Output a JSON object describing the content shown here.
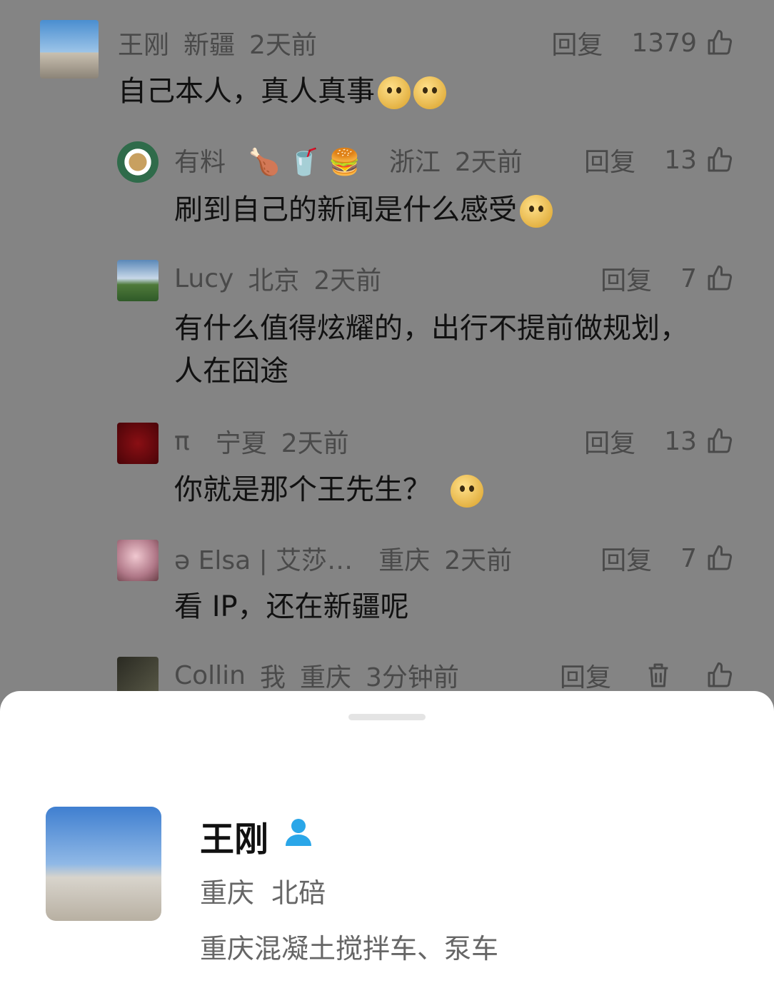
{
  "comments": [
    {
      "user": "王刚",
      "region": "新疆",
      "time": "2天前",
      "reply": "回复",
      "likes": "1379",
      "text": "自己本人，真人真事"
    },
    {
      "user": "有料",
      "region": "浙江",
      "time": "2天前",
      "reply": "回复",
      "likes": "13",
      "text": "刷到自己的新闻是什么感受"
    },
    {
      "user": "Lucy",
      "region": "北京",
      "time": "2天前",
      "reply": "回复",
      "likes": "7",
      "text_line1": "有什么值得炫耀的，出行不提前做规划，",
      "text_line2": "人在囧途"
    },
    {
      "user": "π",
      "region": "宁夏",
      "time": "2天前",
      "reply": "回复",
      "likes": "13",
      "text": "你就是那个王先生？"
    },
    {
      "user": "ə Elsa | 艾莎…",
      "region": "重庆",
      "time": "2天前",
      "reply": "回复",
      "likes": "7",
      "text": "看 IP，还在新疆呢"
    },
    {
      "user": "Collin",
      "tag": "我",
      "region": "重庆",
      "time": "3分钟前",
      "reply": "回复"
    }
  ],
  "profile": {
    "name": "王刚",
    "region": "重庆  北碚",
    "bio": "重庆混凝土搅拌车、泵车"
  },
  "icons": [
    "thumbs-up-icon",
    "trash-icon",
    "person-icon"
  ],
  "colors": {
    "overlay": "#848484",
    "sheet": "#ffffff",
    "accent": "#2aa6e8"
  }
}
